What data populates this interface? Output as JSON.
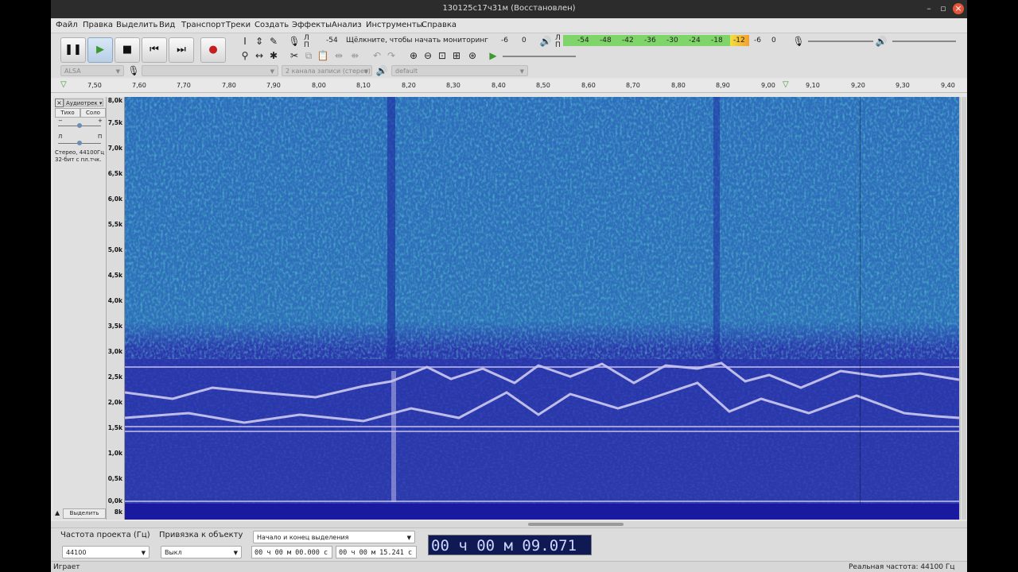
{
  "window": {
    "title": "130125c17ч31м (Восстановлен)"
  },
  "menu": [
    "Файл",
    "Правка",
    "Выделить",
    "Вид",
    "Транспорт",
    "Треки",
    "Создать",
    "Эффекты",
    "Анализ",
    "Инструменты",
    "Справка"
  ],
  "transport": {
    "pause": "pause-icon",
    "play": "play-icon",
    "stop": "stop-icon",
    "skip_start": "skip-start-icon",
    "skip_end": "skip-end-icon",
    "record": "record-icon"
  },
  "record_meter": {
    "l": "Л",
    "r": "П",
    "min": "-54",
    "text": "Щёлкните, чтобы начать мониторинг",
    "minus6": "-6",
    "zero": "0"
  },
  "play_meter": {
    "l": "Л",
    "r": "П",
    "scale": [
      "-54",
      "-48",
      "-42",
      "-36",
      "-30",
      "-24",
      "-18",
      "-12",
      "-6",
      "0"
    ]
  },
  "devices": {
    "host": "ALSA",
    "input": "",
    "channels": "2 канала записи (стерео)",
    "output": "default"
  },
  "ruler": [
    "7,50",
    "7,60",
    "7,70",
    "7,80",
    "7,90",
    "8,00",
    "8,10",
    "8,20",
    "8,30",
    "8,40",
    "8,50",
    "8,60",
    "8,70",
    "8,80",
    "8,90",
    "9,00",
    "9,10",
    "9,20",
    "9,30",
    "9,40"
  ],
  "track": {
    "name": "Аудиотрек",
    "mute": "Тихо",
    "solo": "Соло",
    "gain_minus": "−",
    "gain_plus": "+",
    "pan_l": "Л",
    "pan_r": "П",
    "info": "Стерео, 44100Гц",
    "format": "32-бит с пл.тчк.",
    "select": "Выделить",
    "scale": [
      "8,0k",
      "7,5k",
      "7,0k",
      "6,5k",
      "6,0k",
      "5,5k",
      "5,0k",
      "4,5k",
      "4,0k",
      "3,5k",
      "3,0k",
      "2,5k",
      "2,0k",
      "1,5k",
      "1,0k",
      "0,5k",
      "0,0k"
    ],
    "scale_bottom": "8k"
  },
  "selection": {
    "rate_label": "Частота проекта (Гц)",
    "rate_value": "44100",
    "snap_label": "Привязка к объекту",
    "snap_value": "Выкл",
    "mode": "Начало и конец выделения",
    "start": "00 ч 00 м 00.000 с",
    "end": "00 ч 00 м 15.241 с",
    "audio_position": "00 ч 00 м 09.071 с"
  },
  "status": {
    "left": "Играет",
    "right": "Реальная частота: 44100 Гц"
  }
}
